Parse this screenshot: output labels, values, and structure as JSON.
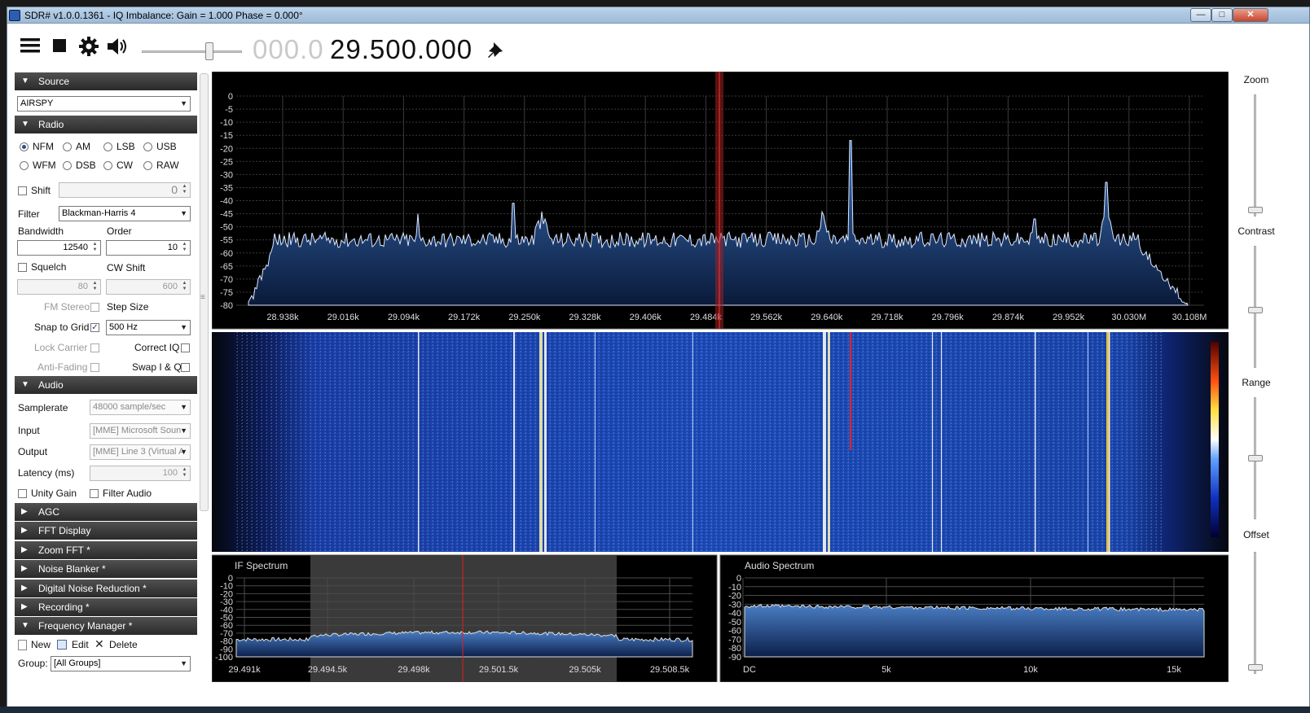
{
  "window": {
    "title": "SDR# v1.0.0.1361 - IQ Imbalance: Gain = 1.000 Phase = 0.000°",
    "minimize": "—",
    "maximize": "□",
    "close": "✕"
  },
  "toolbar": {
    "menu_icon": "hamburger-menu-icon",
    "stop_icon": "stop-icon",
    "settings_icon": "gear-icon",
    "audio_icon": "speaker-icon",
    "frequency_prefix": "000.0",
    "frequency_main": "29.500.000",
    "pin_icon": "pin-icon"
  },
  "sidebar": {
    "source": {
      "title": "Source",
      "device": "AIRSPY"
    },
    "radio": {
      "title": "Radio",
      "modes": [
        "NFM",
        "AM",
        "LSB",
        "USB",
        "WFM",
        "DSB",
        "CW",
        "RAW"
      ],
      "selected_mode": "NFM",
      "shift_label": "Shift",
      "shift_value": "0",
      "filter_label": "Filter",
      "filter_value": "Blackman-Harris 4",
      "bandwidth_label": "Bandwidth",
      "bandwidth_value": "12540",
      "order_label": "Order",
      "order_value": "10",
      "squelch_label": "Squelch",
      "cwshift_label": "CW Shift",
      "squelch_value": "80",
      "cwshift_value": "600",
      "fmstereo_label": "FM Stereo",
      "stepsize_label": "Step Size",
      "snap_label": "Snap to Grid",
      "step_value": "500 Hz",
      "lockcarrier_label": "Lock Carrier",
      "correctiq_label": "Correct IQ",
      "antifading_label": "Anti-Fading",
      "swapiq_label": "Swap I & Q"
    },
    "audio": {
      "title": "Audio",
      "samplerate_label": "Samplerate",
      "samplerate_value": "48000 sample/sec",
      "input_label": "Input",
      "input_value": "[MME] Microsoft Soun",
      "output_label": "Output",
      "output_value": "[MME] Line 3 (Virtual A",
      "latency_label": "Latency (ms)",
      "latency_value": "100",
      "unitygain_label": "Unity Gain",
      "filteraudio_label": "Filter Audio"
    },
    "collapsed_sections": [
      "AGC",
      "FFT Display",
      "Zoom FFT *",
      "Noise Blanker *",
      "Digital Noise Reduction *",
      "Recording *"
    ],
    "frequency_manager": {
      "title": "Frequency Manager *",
      "new_label": "New",
      "edit_label": "Edit",
      "delete_label": "Delete",
      "group_label": "Group:",
      "group_value": "[All Groups]"
    }
  },
  "spectrum": {
    "y_labels": [
      "0",
      "-5",
      "-10",
      "-15",
      "-20",
      "-25",
      "-30",
      "-35",
      "-40",
      "-45",
      "-50",
      "-55",
      "-60",
      "-65",
      "-70",
      "-75",
      "-80"
    ],
    "x_labels": [
      "28.938k",
      "29.016k",
      "29.094k",
      "29.172k",
      "29.250k",
      "29.328k",
      "29.406k",
      "29.484k",
      "29.562k",
      "29.640k",
      "29.718k",
      "29.796k",
      "29.874k",
      "29.952k",
      "30.030M",
      "30.108M"
    ]
  },
  "if_spectrum": {
    "title": "IF Spectrum",
    "y_labels": [
      "0",
      "-10",
      "-20",
      "-30",
      "-40",
      "-50",
      "-60",
      "-70",
      "-80",
      "-90",
      "-100"
    ],
    "x_labels": [
      "29.491k",
      "29.494.5k",
      "29.498k",
      "29.501.5k",
      "29.505k",
      "29.508.5k"
    ]
  },
  "audio_spectrum": {
    "title": "Audio Spectrum",
    "y_labels": [
      "0",
      "-10",
      "-20",
      "-30",
      "-40",
      "-50",
      "-60",
      "-70",
      "-80",
      "-90"
    ],
    "x_labels": [
      "DC",
      "5k",
      "10k",
      "15k"
    ]
  },
  "right_panel": {
    "zoom_label": "Zoom",
    "contrast_label": "Contrast",
    "range_label": "Range",
    "offset_label": "Offset"
  }
}
